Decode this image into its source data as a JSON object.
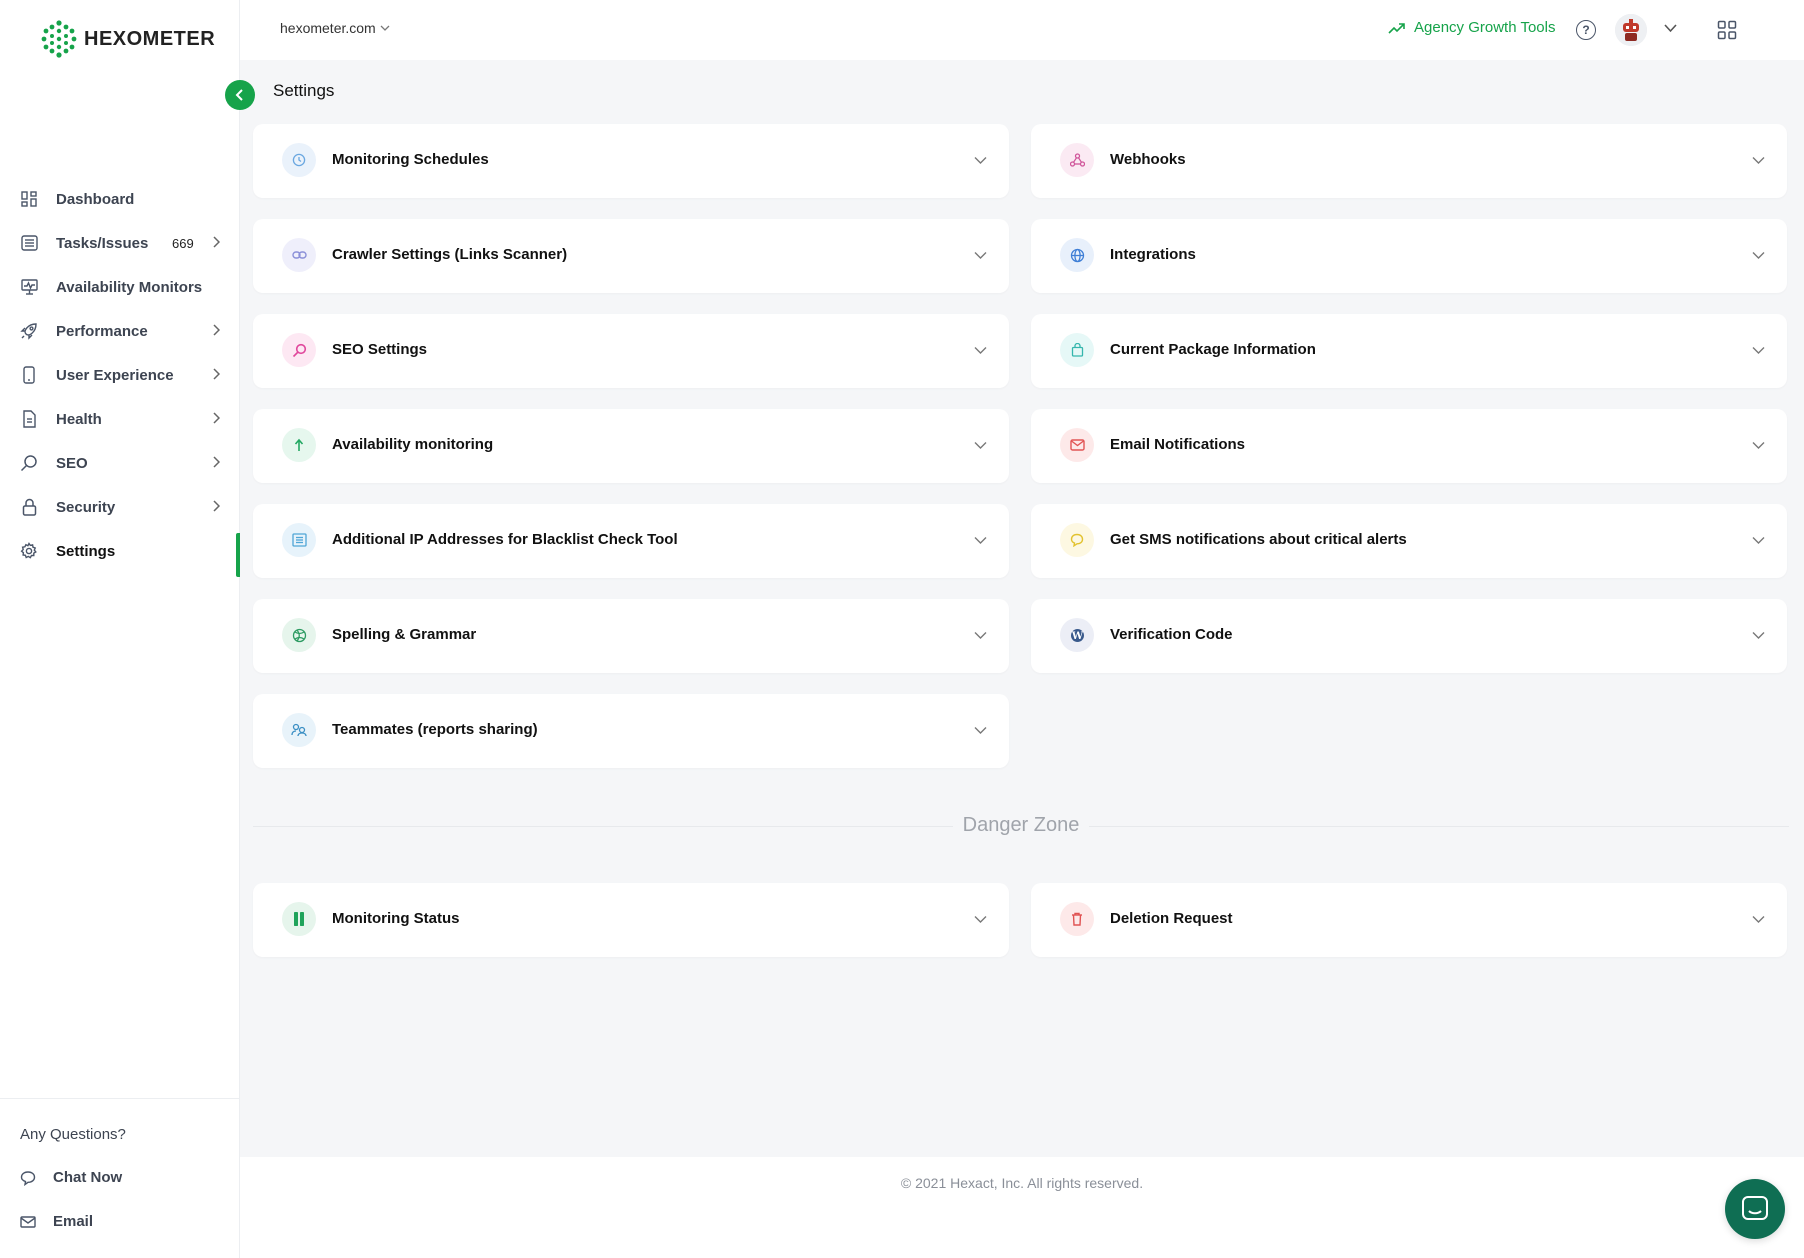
{
  "brand": {
    "name": "HEXOMETER",
    "accent": "#16a34a"
  },
  "topbar": {
    "domain": "hexometer.com",
    "agency_label": "Agency Growth Tools",
    "help_label": "?"
  },
  "sidebar": {
    "items": [
      {
        "label": "Dashboard",
        "icon": "dashboard-icon"
      },
      {
        "label": "Tasks/Issues",
        "count": "669",
        "icon": "tasks-icon"
      },
      {
        "label": "Availability Monitors",
        "icon": "monitor-icon"
      },
      {
        "label": "Performance",
        "icon": "rocket-icon"
      },
      {
        "label": "User Experience",
        "icon": "phone-icon"
      },
      {
        "label": "Health",
        "icon": "document-icon"
      },
      {
        "label": "SEO",
        "icon": "search-icon"
      },
      {
        "label": "Security",
        "icon": "lock-icon"
      },
      {
        "label": "Settings",
        "icon": "gear-icon",
        "active": true
      }
    ],
    "help": {
      "title": "Any Questions?",
      "chat": "Chat Now",
      "email": "Email"
    }
  },
  "page": {
    "title": "Settings"
  },
  "cards_left": [
    {
      "title": "Monitoring Schedules",
      "icon": "clock-icon"
    },
    {
      "title": "Crawler Settings (Links Scanner)",
      "icon": "link-icon"
    },
    {
      "title": "SEO Settings",
      "icon": "search-icon"
    },
    {
      "title": "Availability monitoring",
      "icon": "upload-arrow-icon"
    },
    {
      "title": "Additional IP Addresses for Blacklist Check Tool",
      "icon": "list-icon"
    },
    {
      "title": "Spelling & Grammar",
      "icon": "globe-grid-icon"
    },
    {
      "title": "Teammates (reports sharing)",
      "icon": "team-icon"
    }
  ],
  "cards_right": [
    {
      "title": "Webhooks",
      "icon": "webhook-icon"
    },
    {
      "title": "Integrations",
      "icon": "globe-icon"
    },
    {
      "title": "Current Package Information",
      "icon": "bag-icon"
    },
    {
      "title": "Email Notifications",
      "icon": "mail-icon"
    },
    {
      "title": "Get SMS notifications about critical alerts",
      "icon": "chat-bubble-icon"
    },
    {
      "title": "Verification Code",
      "icon": "wordpress-icon"
    }
  ],
  "danger": {
    "label": "Danger Zone",
    "monitoring_status": "Monitoring Status",
    "deletion_request": "Deletion Request"
  },
  "footer": {
    "text": "© 2021 Hexact, Inc. All rights reserved."
  }
}
